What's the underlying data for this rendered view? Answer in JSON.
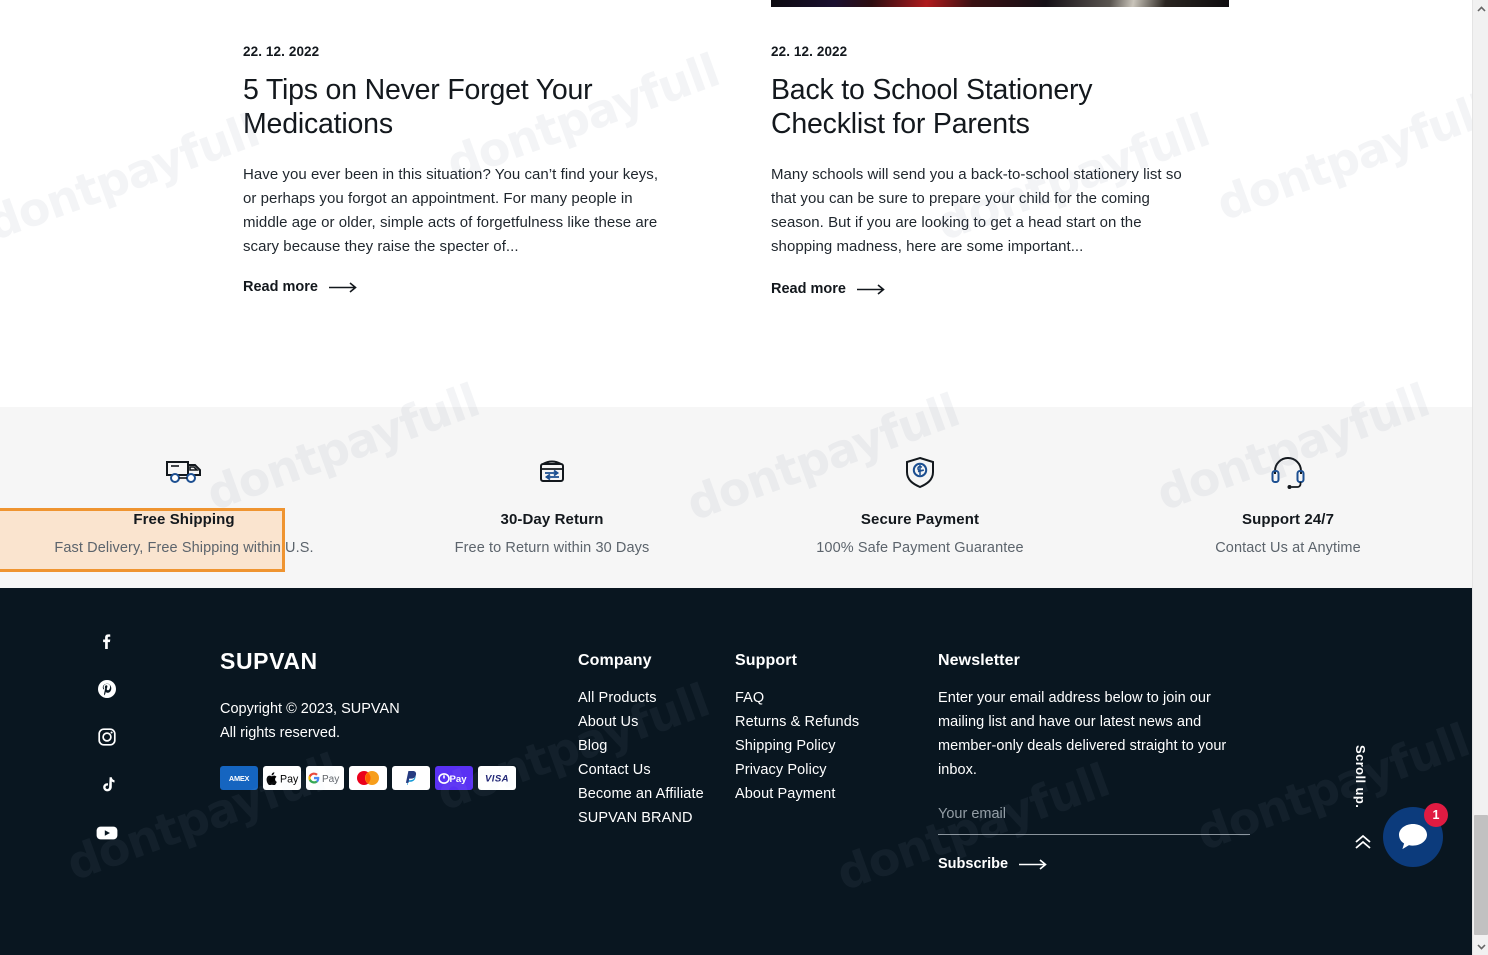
{
  "blog": {
    "posts": [
      {
        "date": "22. 12. 2022",
        "title": "5 Tips on Never Forget Your Medications",
        "excerpt": "Have you ever been in this situation? You can’t find your keys, or perhaps you forgot an appointment. For many people in middle age or older, simple acts of forgetfulness like these are scary because they raise the specter of...",
        "read_more": "Read more"
      },
      {
        "date": "22. 12. 2022",
        "title": "Back to School Stationery Checklist for Parents",
        "excerpt": "Many schools will send you a back-to-school stationery list so that you can be sure to prepare your child for the coming season. But if you are looking to get a head start on the shopping madness, here are some important...",
        "read_more": "Read more"
      }
    ]
  },
  "features": [
    {
      "icon": "delivery-truck-icon",
      "title": "Free Shipping",
      "subtitle": "Fast Delivery, Free Shipping within U.S.",
      "highlight_fill": "#fae4cf",
      "highlight_border": "#ef9430"
    },
    {
      "icon": "return-box-icon",
      "title": "30-Day Return",
      "subtitle": "Free to Return within 30 Days"
    },
    {
      "icon": "shield-dollar-icon",
      "title": "Secure Payment",
      "subtitle": "100% Safe Payment Guarantee"
    },
    {
      "icon": "headset-icon",
      "title": "Support 24/7",
      "subtitle": "Contact Us at Anytime"
    }
  ],
  "footer": {
    "background": "#091620",
    "brand": {
      "name": "SUPVAN",
      "copyright_line1": "Copyright © 2023, SUPVAN",
      "copyright_line2": "All rights reserved."
    },
    "social": [
      {
        "icon": "facebook-icon",
        "name": "Facebook"
      },
      {
        "icon": "pinterest-icon",
        "name": "Pinterest"
      },
      {
        "icon": "instagram-icon",
        "name": "Instagram"
      },
      {
        "icon": "tiktok-icon",
        "name": "TikTok"
      },
      {
        "icon": "youtube-icon",
        "name": "YouTube"
      }
    ],
    "payments": [
      {
        "icon": "amex-icon",
        "label": "AMEX"
      },
      {
        "icon": "apple-pay-icon",
        "label": "Pay"
      },
      {
        "icon": "google-pay-icon",
        "label": "Pay"
      },
      {
        "icon": "mastercard-icon",
        "label": "Mastercard"
      },
      {
        "icon": "paypal-icon",
        "label": "PayPal"
      },
      {
        "icon": "shop-pay-icon",
        "label": "Pay"
      },
      {
        "icon": "visa-icon",
        "label": "VISA"
      }
    ],
    "columns": [
      {
        "heading": "Company",
        "links": [
          "All Products",
          "About Us",
          "Blog",
          "Contact Us",
          "Become an Affiliate",
          "SUPVAN BRAND"
        ]
      },
      {
        "heading": "Support",
        "links": [
          "FAQ",
          "Returns & Refunds",
          "Shipping Policy",
          "Privacy Policy",
          "About Payment"
        ]
      }
    ],
    "newsletter": {
      "heading": "Newsletter",
      "text": "Enter your email address below to join our mailing list and have our latest news and member-only deals delivered straight to your inbox.",
      "placeholder": "Your email",
      "value": "",
      "subscribe_label": "Subscribe"
    }
  },
  "right_rail": {
    "scroll_up_label": "Scroll up.",
    "chat": {
      "badge_count": "1",
      "accent": "#0c3b7c",
      "badge_color": "#e01b42"
    }
  },
  "watermark": {
    "text": "dontpayfull"
  }
}
